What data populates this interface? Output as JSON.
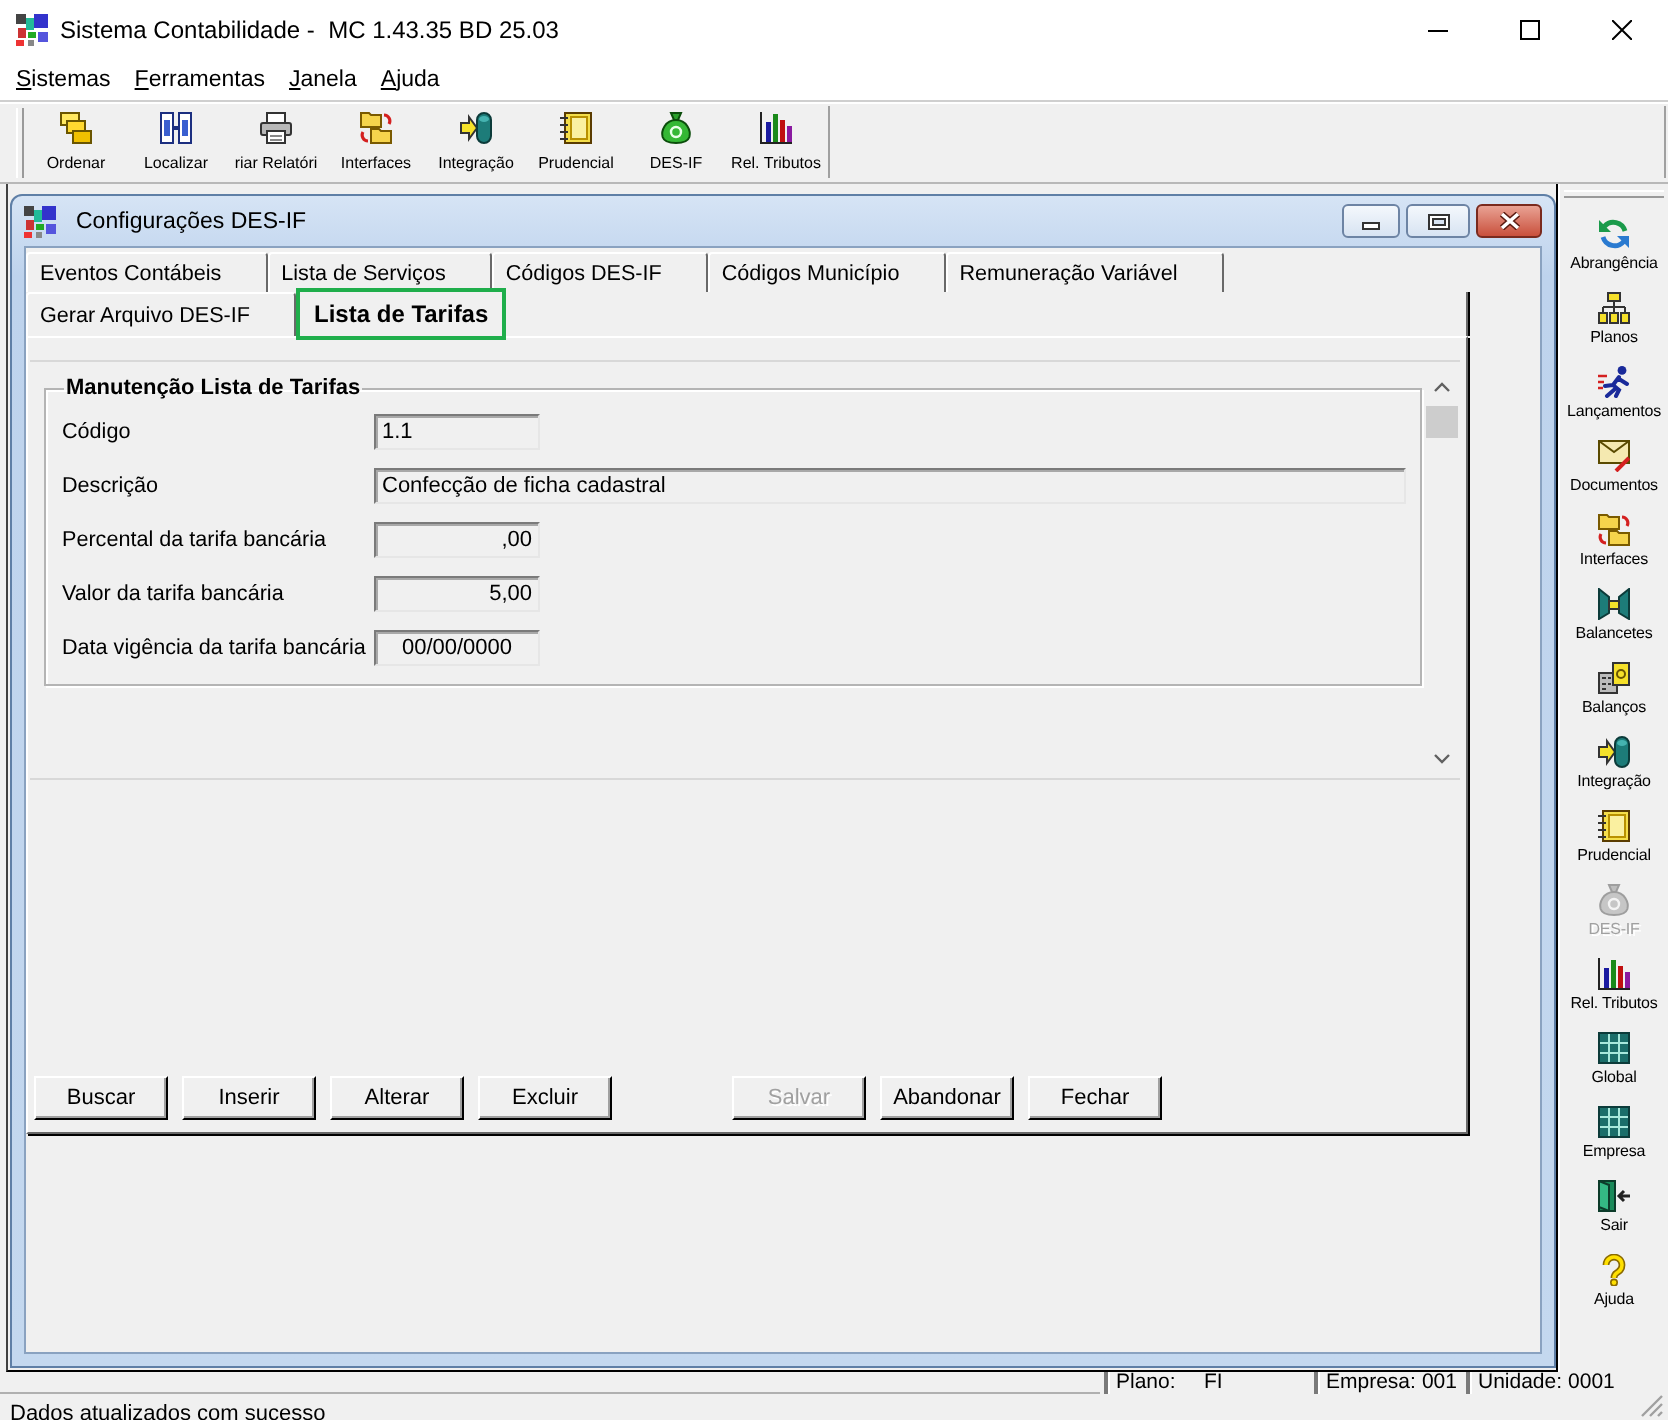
{
  "window": {
    "title": "Sistema Contabilidade -  MC 1.43.35 BD 25.03"
  },
  "menu": [
    "Sistemas",
    "Ferramentas",
    "Janela",
    "Ajuda"
  ],
  "toolbar": [
    {
      "label": "Ordenar"
    },
    {
      "label": "Localizar"
    },
    {
      "label": "riar Relatóri"
    },
    {
      "label": "Interfaces"
    },
    {
      "label": "Integração"
    },
    {
      "label": "Prudencial"
    },
    {
      "label": "DES-IF"
    },
    {
      "label": "Rel. Tributos"
    }
  ],
  "child_window": {
    "title": "Configurações DES-IF",
    "tab_rows": [
      [
        {
          "label": "Eventos Contábeis",
          "selected": false
        },
        {
          "label": "Lista de Serviços",
          "selected": false
        },
        {
          "label": "Códigos DES-IF",
          "selected": false
        },
        {
          "label": "Códigos Município",
          "selected": false
        },
        {
          "label": "Remuneração Variável",
          "selected": false
        }
      ],
      [
        {
          "label": "Gerar Arquivo DES-IF",
          "selected": false
        },
        {
          "label": "Lista de Tarifas",
          "selected": true
        }
      ]
    ],
    "group": {
      "title": "Manutenção Lista de Tarifas",
      "fields": [
        {
          "label": "Código",
          "value": "1.1",
          "kind": "text"
        },
        {
          "label": "Descrição",
          "value": "Confecção de ficha cadastral",
          "kind": "wide"
        },
        {
          "label": "Percental da tarifa bancária",
          "value": ",00",
          "kind": "number"
        },
        {
          "label": "Valor da tarifa bancária",
          "value": "5,00",
          "kind": "number"
        },
        {
          "label": "Data vigência da tarifa bancária",
          "value": "00/00/0000",
          "kind": "date"
        }
      ]
    },
    "button_groups": [
      [
        {
          "label": "Buscar",
          "disabled": false
        },
        {
          "label": "Inserir",
          "disabled": false
        },
        {
          "label": "Alterar",
          "disabled": false
        },
        {
          "label": "Excluir",
          "disabled": false
        }
      ],
      [
        {
          "label": "Salvar",
          "disabled": true
        },
        {
          "label": "Abandonar",
          "disabled": false
        },
        {
          "label": "Fechar",
          "disabled": false
        }
      ]
    ]
  },
  "sidebar": [
    {
      "label": "Abrangência",
      "disabled": false
    },
    {
      "label": "Planos",
      "disabled": false
    },
    {
      "label": "Lançamentos",
      "disabled": false
    },
    {
      "label": "Documentos",
      "disabled": false
    },
    {
      "label": "Interfaces",
      "disabled": false
    },
    {
      "label": "Balancetes",
      "disabled": false
    },
    {
      "label": "Balanços",
      "disabled": false
    },
    {
      "label": "Integração",
      "disabled": false
    },
    {
      "label": "Prudencial",
      "disabled": false
    },
    {
      "label": "DES-IF",
      "disabled": true
    },
    {
      "label": "Rel. Tributos",
      "disabled": false
    },
    {
      "label": "Global",
      "disabled": false
    },
    {
      "label": "Empresa",
      "disabled": false
    },
    {
      "label": "Sair",
      "disabled": false
    },
    {
      "label": "Ajuda",
      "disabled": false
    }
  ],
  "status_bar": {
    "message": "Dados atualizados com sucesso",
    "panels": [
      {
        "label": "Plano:",
        "value": "FI"
      },
      {
        "label": "Empresa:",
        "value": "001"
      },
      {
        "label": "Unidade:",
        "value": "0001"
      }
    ]
  }
}
